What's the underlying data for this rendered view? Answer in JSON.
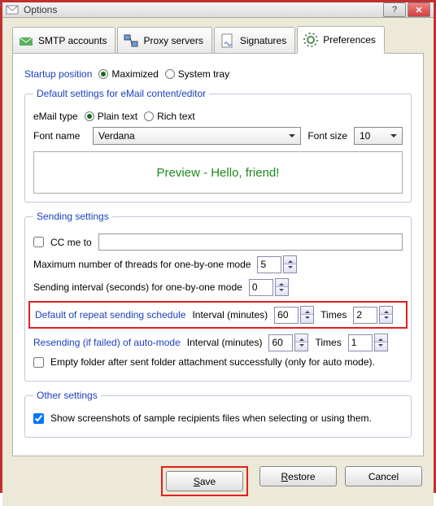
{
  "window": {
    "title": "Options"
  },
  "tabs": {
    "smtp": "SMTP accounts",
    "proxy": "Proxy servers",
    "signatures": "Signatures",
    "preferences": "Preferences"
  },
  "startup": {
    "label": "Startup position",
    "maximized": "Maximized",
    "systray": "System tray"
  },
  "editor": {
    "legend": "Default settings for eMail content/editor",
    "email_type": "eMail type",
    "plain": "Plain text",
    "rich": "Rich text",
    "font_name_lbl": "Font name",
    "font_name_val": "Verdana",
    "font_size_lbl": "Font size",
    "font_size_val": "10",
    "preview": "Preview - Hello, friend!"
  },
  "sending": {
    "legend": "Sending settings",
    "cc_me": "CC me to",
    "cc_value": "",
    "threads_lbl": "Maximum number of threads for one-by-one mode",
    "threads_val": "5",
    "interval_lbl": "Sending interval (seconds) for one-by-one mode",
    "interval_val": "0",
    "repeat_lbl": "Default of repeat sending schedule",
    "interval_min_lbl": "Interval (minutes)",
    "repeat_interval": "60",
    "times_lbl": "Times",
    "repeat_times": "2",
    "resend_lbl": "Resending (if failed) of auto-mode",
    "resend_interval": "60",
    "resend_times": "1",
    "empty_folder": "Empty folder after sent folder attachment successfully (only for auto mode)."
  },
  "other": {
    "legend": "Other settings",
    "show_screens": "Show screenshots of sample recipients files when selecting or using them."
  },
  "buttons": {
    "save": "Save",
    "restore": "Restore",
    "cancel": "Cancel"
  }
}
